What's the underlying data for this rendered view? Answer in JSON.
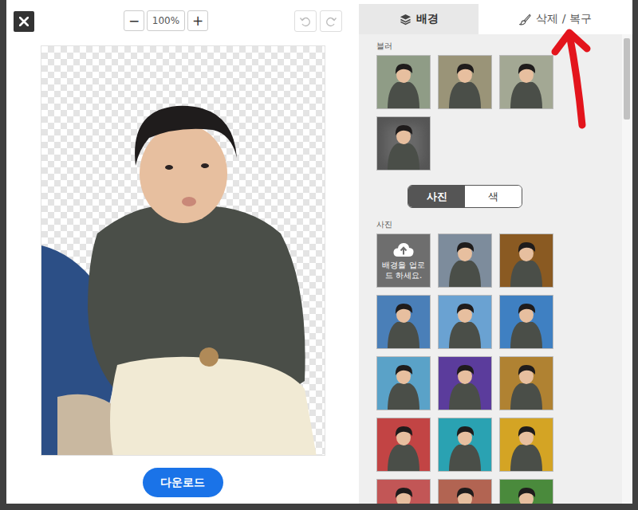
{
  "toolbar": {
    "zoom_out": "−",
    "zoom": "100%",
    "zoom_in": "+",
    "undo_disabled": true,
    "redo_disabled": true
  },
  "download": "다운로드",
  "tabs": [
    {
      "label": "배경",
      "selected": true
    },
    {
      "label": "삭제 / 복구",
      "selected": false
    }
  ],
  "blur": {
    "label": "블러",
    "tiles": [
      {
        "kind": "blur",
        "color": "#8f9c86"
      },
      {
        "kind": "blur",
        "color": "#9a9478"
      },
      {
        "kind": "blur",
        "color": "#a3a894"
      },
      {
        "kind": "vignette",
        "color": "#6a6a6a"
      }
    ]
  },
  "mode": [
    {
      "label": "사진",
      "selected": true
    },
    {
      "label": "색",
      "selected": false
    }
  ],
  "photos": {
    "label": "사진",
    "tiles": [
      {
        "kind": "upload",
        "label": "배경을 업로드 하세요.",
        "color": "#6e6e6e"
      },
      {
        "kind": "photo",
        "color": "#7d8c9c"
      },
      {
        "kind": "photo",
        "color": "#8a5a22"
      },
      {
        "kind": "photo",
        "color": "#4a7fb8"
      },
      {
        "kind": "photo",
        "color": "#6aa2d2"
      },
      {
        "kind": "photo",
        "color": "#3f80c2"
      },
      {
        "kind": "photo",
        "color": "#5aa2c8"
      },
      {
        "kind": "photo",
        "color": "#5b3c9c"
      },
      {
        "kind": "photo",
        "color": "#b08232"
      },
      {
        "kind": "photo",
        "color": "#c24444"
      },
      {
        "kind": "photo",
        "color": "#2aa2b2"
      },
      {
        "kind": "photo",
        "color": "#d4a424"
      },
      {
        "kind": "photo",
        "color": "#c25656"
      },
      {
        "kind": "photo",
        "color": "#b26452"
      },
      {
        "kind": "photo",
        "color": "#4a8a3c"
      }
    ]
  }
}
